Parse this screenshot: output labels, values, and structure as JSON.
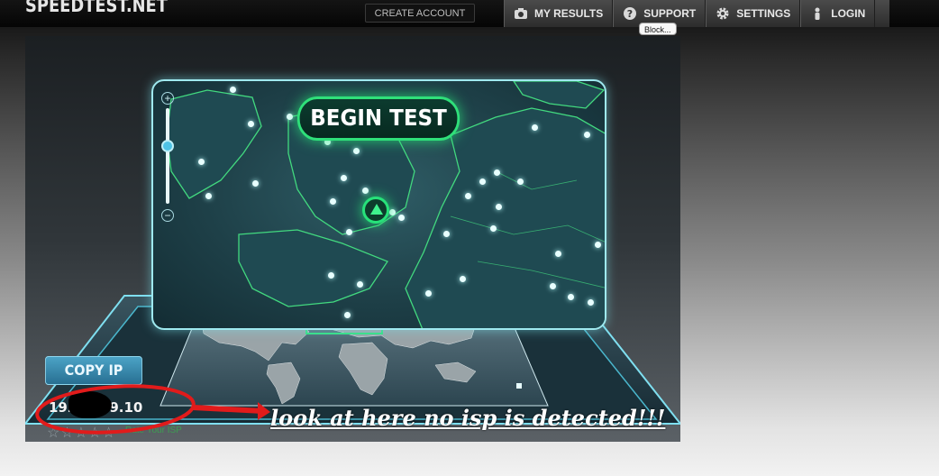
{
  "header": {
    "logo": "SPEEDTEST.NET",
    "create_account": "CREATE ACCOUNT",
    "nav": [
      {
        "label": "MY RESULTS",
        "icon": "camera-icon"
      },
      {
        "label": "SUPPORT",
        "icon": "question-icon"
      },
      {
        "label": "SETTINGS",
        "icon": "gear-icon"
      },
      {
        "label": "LOGIN",
        "icon": "user-icon"
      }
    ],
    "tooltip": "Block..."
  },
  "map": {
    "begin_test": "BEGIN TEST",
    "zoom_plus": "+",
    "zoom_minus": "−",
    "zoom_level": 0.6
  },
  "connection": {
    "copy_ip": "COPY IP",
    "ip_prefix": "192",
    "ip_suffix": "9.10",
    "rate_isp": "Rate Your ISP",
    "rating_stars": 5
  },
  "annotation": {
    "text": "look at here no isp is detected!!!"
  },
  "colors": {
    "accent_green": "#2fe07a",
    "annotation_red": "#e11b1b",
    "map_glow": "#9fe9ef"
  }
}
